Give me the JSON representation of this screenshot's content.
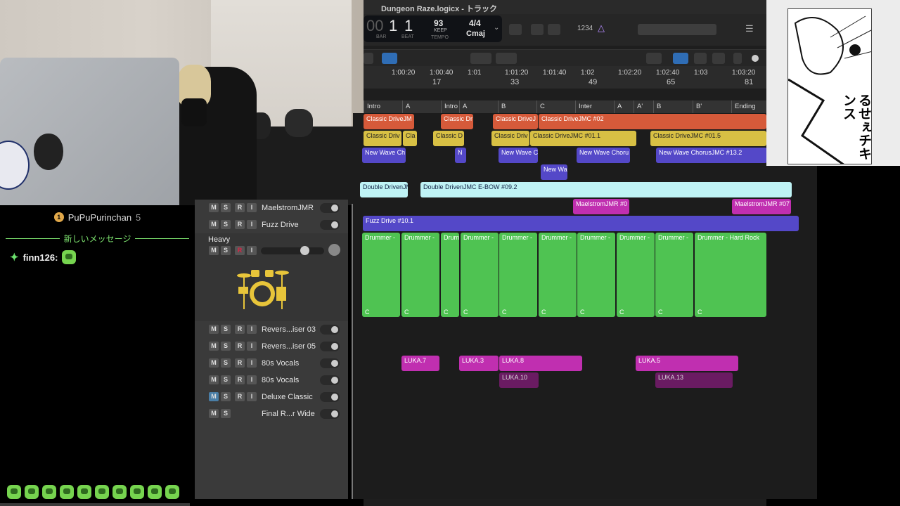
{
  "window": {
    "title": "Dungeon Raze.logicx - トラック"
  },
  "lcd": {
    "bar": "1",
    "beat": "1",
    "bar_label": "BAR",
    "beat_label": "BEAT",
    "tempo": "93",
    "tempo_mode": "KEEP",
    "tempo_label": "TEMPO",
    "signature": "4/4",
    "key": "Cmaj"
  },
  "toolbar": {
    "count_in": "1234"
  },
  "ruler": {
    "times": [
      "1:00:20",
      "1:00:40",
      "1:01",
      "1:01:20",
      "1:01:40",
      "1:02",
      "1:02:20",
      "1:02:40",
      "1:03",
      "1:03:20"
    ],
    "bars": [
      "17",
      "33",
      "49",
      "65",
      "81"
    ]
  },
  "arrangement": [
    "Intro",
    "A",
    "Intro",
    "A",
    "B",
    "C",
    "Inter",
    "A",
    "A'",
    "B",
    "B'",
    "Ending"
  ],
  "regions": {
    "red": [
      "Classic DriveJM",
      "Classic Dr",
      "Classic DriveJ",
      "Classic DriveJMC #02"
    ],
    "yellow": [
      "Classic Driv",
      "Cla",
      "Classic D",
      "Classic Driv",
      "Classic DriveJMC #01.1",
      "Classic DriveJMC #01.5"
    ],
    "purple": [
      "New Wave Ch",
      "N",
      "New Wave C",
      "New Wave Choru",
      "New Wave ChorusJMC #13.2",
      "New Wa"
    ],
    "cyan": [
      "Double DrivenJM",
      "Double DrivenJMC E-BOW #09.2"
    ],
    "magenta": [
      "MaelstromJMR #0",
      "MaelstromJMR #07"
    ],
    "fuzz": "Fuzz Drive #10.1",
    "drummer": [
      "Drummer -",
      "Drummer -",
      "Drum",
      "Drummer -",
      "Drummer -",
      "Drummer -",
      "Drummer -",
      "Drummer -",
      "Drummer -",
      "Drummer - Hard Rock"
    ],
    "drummer_marker": "C",
    "vocals": [
      "LUKA.7",
      "LUKA.3",
      "LUKA.8",
      "LUKA.5"
    ],
    "vocals2": [
      "LUKA.10",
      "LUKA.13"
    ]
  },
  "tracks": [
    {
      "name": "MaelstromJMR"
    },
    {
      "name": "Fuzz Drive"
    },
    {
      "name": "Heavy"
    },
    {
      "name": "Revers...iser 03"
    },
    {
      "name": "Revers...iser 05"
    },
    {
      "name": "80s Vocals"
    },
    {
      "name": "80s Vocals"
    },
    {
      "name": "Deluxe Classic"
    },
    {
      "name": "Final R...r Wide"
    }
  ],
  "buttons": {
    "mute": "M",
    "solo": "S",
    "record": "R",
    "input": "I"
  },
  "chat": {
    "rank": "1",
    "top_user": "PuPuPurinchan",
    "top_count": "5",
    "new_messages": "新しいメッセージ",
    "messages": [
      {
        "user": "finn126:"
      }
    ]
  },
  "manga": {
    "text": "るせぇチキンス"
  },
  "colors": {
    "accent_green": "#7de36f",
    "region_red": "#d65a3a",
    "region_yellow": "#d8c044",
    "region_purple": "#5448c8",
    "region_cyan": "#bff3f5",
    "region_magenta": "#c02fb0",
    "drummer_green": "#4fc352"
  }
}
